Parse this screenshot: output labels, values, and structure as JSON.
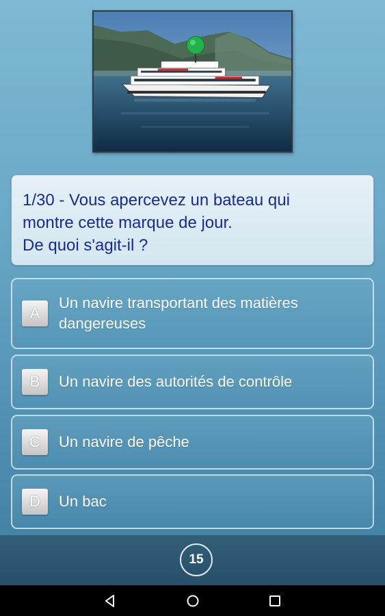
{
  "question": {
    "text": "1/30 - Vous apercevez un bateau qui\nmontre cette marque de jour.\nDe quoi s'agit-il ?"
  },
  "illustration": {
    "description_icon": "boat-with-green-ball-icon",
    "day_mark_color": "#22b14c"
  },
  "answers": [
    {
      "letter": "A",
      "text": "Un navire transportant des matières dangereuses"
    },
    {
      "letter": "B",
      "text": "Un navire des autorités de contrôle"
    },
    {
      "letter": "C",
      "text": "Un navire de pêche"
    },
    {
      "letter": "D",
      "text": "Un bac"
    }
  ],
  "timer": {
    "value": "15"
  },
  "navbar": {
    "back_icon": "back-triangle-icon",
    "home_icon": "home-circle-icon",
    "recent_icon": "recent-square-icon"
  },
  "colors": {
    "question_text": "#1a2b8c",
    "answer_text": "#ffffff"
  }
}
